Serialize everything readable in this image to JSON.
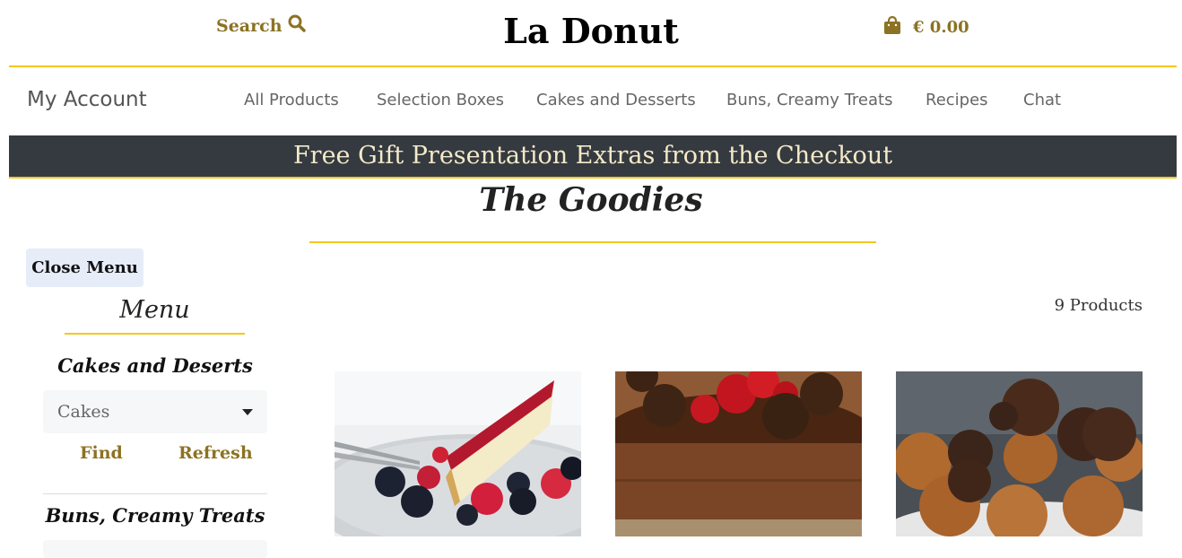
{
  "header": {
    "search_label": "Search",
    "brand": "La Donut",
    "cart_total": "€ 0.00"
  },
  "nav": {
    "account": "My Account",
    "links": [
      "All Products",
      "Selection Boxes",
      "Cakes and Desserts",
      "Buns, Creamy Treats",
      "Recipes",
      "Chat"
    ]
  },
  "banner": "Free Gift Presentation Extras from the Checkout",
  "section_title": "The Goodies",
  "sidebar": {
    "close_label": "Close Menu",
    "menu_title": "Menu",
    "categories": [
      {
        "title": "Cakes and Deserts",
        "selected": "Cakes",
        "find_label": "Find",
        "refresh_label": "Refresh"
      },
      {
        "title": "Buns, Creamy Treats"
      }
    ]
  },
  "product_count": "9 Products",
  "products": [
    {
      "image": "cheesecake-with-berries"
    },
    {
      "image": "chocolate-cake-with-strawberries"
    },
    {
      "image": "chocolate-chip-cookies"
    }
  ],
  "colors": {
    "accent_gold": "#f2c81d",
    "link_gold": "#8c7222",
    "banner_bg": "#343a40"
  },
  "icons": [
    "search-icon",
    "shopping-bag-icon",
    "chevron-down-icon"
  ]
}
